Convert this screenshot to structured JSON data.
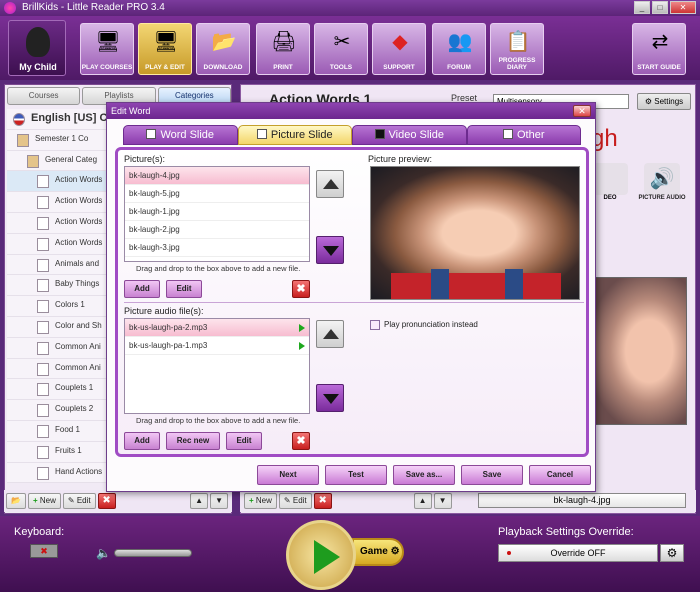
{
  "window": {
    "title": "BrillKids - Little Reader PRO 3.4"
  },
  "toolbar": {
    "my_child": "My Child",
    "buttons": [
      {
        "label": "PLAY COURSES",
        "icon": "monitor-icon"
      },
      {
        "label": "PLAY & EDIT",
        "icon": "monitor-pencil-icon"
      },
      {
        "label": "DOWNLOAD",
        "icon": "folder-download-icon"
      },
      {
        "label": "PRINT",
        "icon": "printer-icon"
      },
      {
        "label": "TOOLS",
        "icon": "tools-icon"
      },
      {
        "label": "SUPPORT",
        "icon": "help-diamond-icon"
      },
      {
        "label": "FORUM",
        "icon": "people-icon"
      },
      {
        "label": "PROGRESS DIARY",
        "icon": "clipboard-icon"
      },
      {
        "label": "START GUIDE",
        "icon": "signpost-icon"
      }
    ]
  },
  "left": {
    "tabs": [
      "Courses",
      "Playlists",
      "Categories"
    ],
    "tree": [
      {
        "label": "English [US] C",
        "level": 0,
        "root": true
      },
      {
        "label": "Semester 1 Co",
        "level": 1
      },
      {
        "label": "General Categ",
        "level": 2
      },
      {
        "label": "Action Words",
        "level": 3,
        "hl": true
      },
      {
        "label": "Action Words",
        "level": 3
      },
      {
        "label": "Action Words",
        "level": 3
      },
      {
        "label": "Action Words",
        "level": 3
      },
      {
        "label": "Animals and",
        "level": 3
      },
      {
        "label": "Baby Things",
        "level": 3
      },
      {
        "label": "Colors 1",
        "level": 3
      },
      {
        "label": "Color and Sh",
        "level": 3
      },
      {
        "label": "Common Ani",
        "level": 3
      },
      {
        "label": "Common Ani",
        "level": 3
      },
      {
        "label": "Couplets 1",
        "level": 3
      },
      {
        "label": "Couplets 2",
        "level": 3
      },
      {
        "label": "Food 1",
        "level": 3
      },
      {
        "label": "Fruits 1",
        "level": 3
      },
      {
        "label": "Hand Actions",
        "level": 3
      }
    ],
    "bottom": {
      "new": "New",
      "edit": "Edit"
    }
  },
  "right": {
    "title": "Action Words 1",
    "preset_label": "Preset",
    "preset_value": "Multisensory",
    "settings": "Settings",
    "big_word": "gh",
    "deo_label": "DEO",
    "picture_audio_label": "PICTURE AUDIO",
    "bottom": {
      "new": "New",
      "edit": "Edit",
      "file": "bk-laugh-4.jpg"
    }
  },
  "dialog": {
    "title": "Edit Word",
    "tabs": [
      "Word Slide",
      "Picture Slide",
      "Video Slide",
      "Other"
    ],
    "pictures_label": "Picture(s):",
    "pictures": [
      "bk-laugh-4.jpg",
      "bk-laugh-5.jpg",
      "bk-laugh-1.jpg",
      "bk-laugh-2.jpg",
      "bk-laugh-3.jpg"
    ],
    "pictures_hint": "Drag and drop to the box above to add a new file.",
    "add": "Add",
    "edit": "Edit",
    "preview_label": "Picture preview:",
    "audio_label": "Picture audio file(s):",
    "audio_files": [
      "bk-us-laugh-pa-2.mp3",
      "bk-us-laugh-pa-1.mp3"
    ],
    "audio_hint": "Drag and drop to the box above to add a new file.",
    "rec_new": "Rec new",
    "play_pron": "Play pronunciation instead",
    "footer": {
      "next": "Next",
      "test": "Test",
      "save_as": "Save as...",
      "save": "Save",
      "cancel": "Cancel"
    }
  },
  "bottom": {
    "keyboard": "Keyboard:",
    "game": "Game",
    "playback": "Playback Settings Override:",
    "override": "Override OFF"
  }
}
